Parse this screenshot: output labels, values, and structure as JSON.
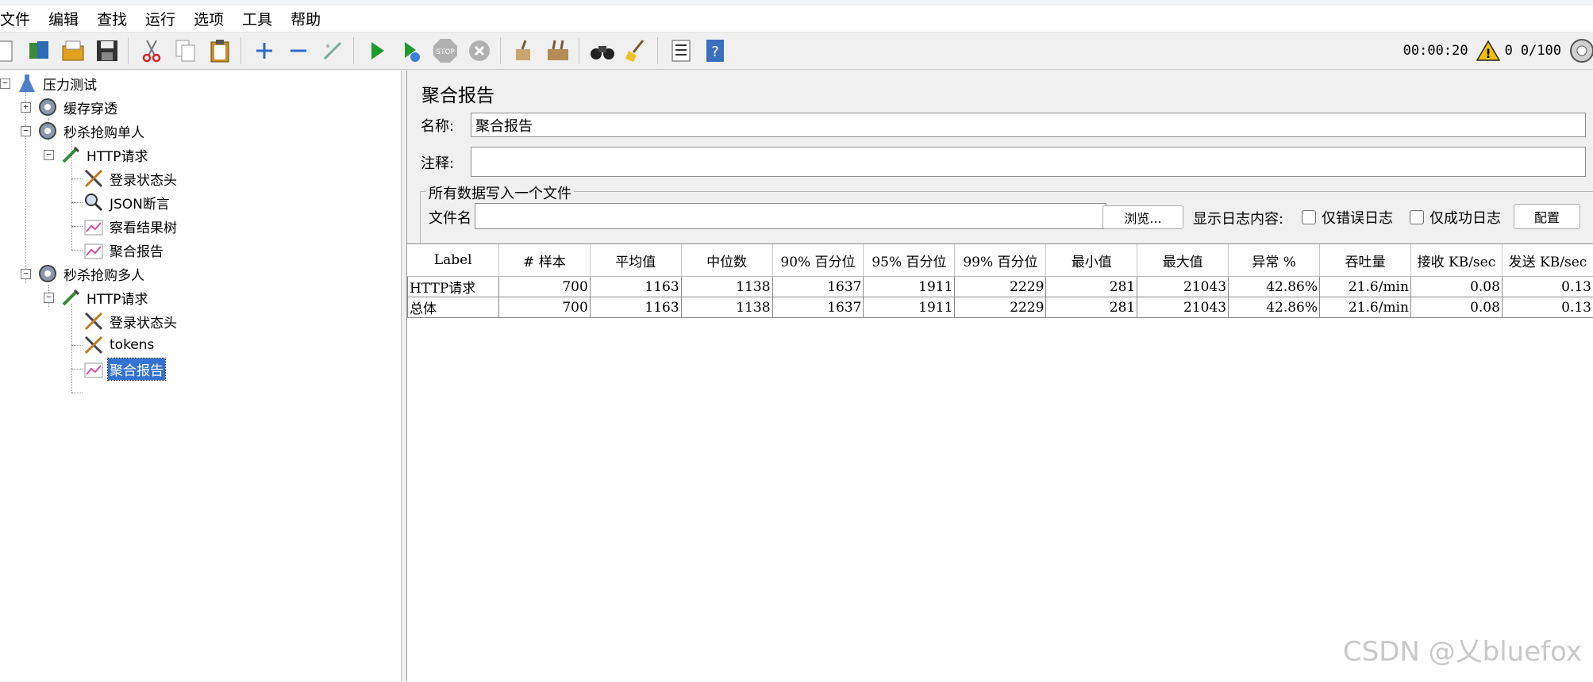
{
  "menu": [
    "文件",
    "编辑",
    "查找",
    "运行",
    "选项",
    "工具",
    "帮助"
  ],
  "toolbar": {
    "timer": "00:00:20",
    "errors": "0",
    "threads": "0/100"
  },
  "tree": {
    "root": "压力测试",
    "items": [
      {
        "label": "缓存穿透"
      },
      {
        "label": "秒杀抢购单人"
      },
      {
        "label": "HTTP请求"
      },
      {
        "label": "登录状态头"
      },
      {
        "label": "JSON断言"
      },
      {
        "label": "察看结果树"
      },
      {
        "label": "聚合报告"
      },
      {
        "label": "秒杀抢购多人"
      },
      {
        "label": "HTTP请求"
      },
      {
        "label": "登录状态头"
      },
      {
        "label": "tokens"
      },
      {
        "label": "聚合报告"
      }
    ]
  },
  "panel": {
    "title": "聚合报告",
    "name_label": "名称:",
    "name_value": "聚合报告",
    "comment_label": "注释:",
    "comment_value": "",
    "file_group": "所有数据写入一个文件",
    "file_label": "文件名",
    "file_value": "",
    "browse": "浏览...",
    "log_label": "显示日志内容:",
    "errors_only": "仅错误日志",
    "success_only": "仅成功日志",
    "configure": "配置"
  },
  "table": {
    "headers": [
      "Label",
      "# 样本",
      "平均值",
      "中位数",
      "90% 百分位",
      "95% 百分位",
      "99% 百分位",
      "最小值",
      "最大值",
      "异常 %",
      "吞吐量",
      "接收 KB/sec",
      "发送 KB/sec"
    ],
    "rows": [
      [
        "HTTP请求",
        "700",
        "1163",
        "1138",
        "1637",
        "1911",
        "2229",
        "281",
        "21043",
        "42.86%",
        "21.6/min",
        "0.08",
        "0.13"
      ],
      [
        "总体",
        "700",
        "1163",
        "1138",
        "1637",
        "1911",
        "2229",
        "281",
        "21043",
        "42.86%",
        "21.6/min",
        "0.08",
        "0.13"
      ]
    ]
  },
  "watermark": "CSDN @乂bluefox"
}
